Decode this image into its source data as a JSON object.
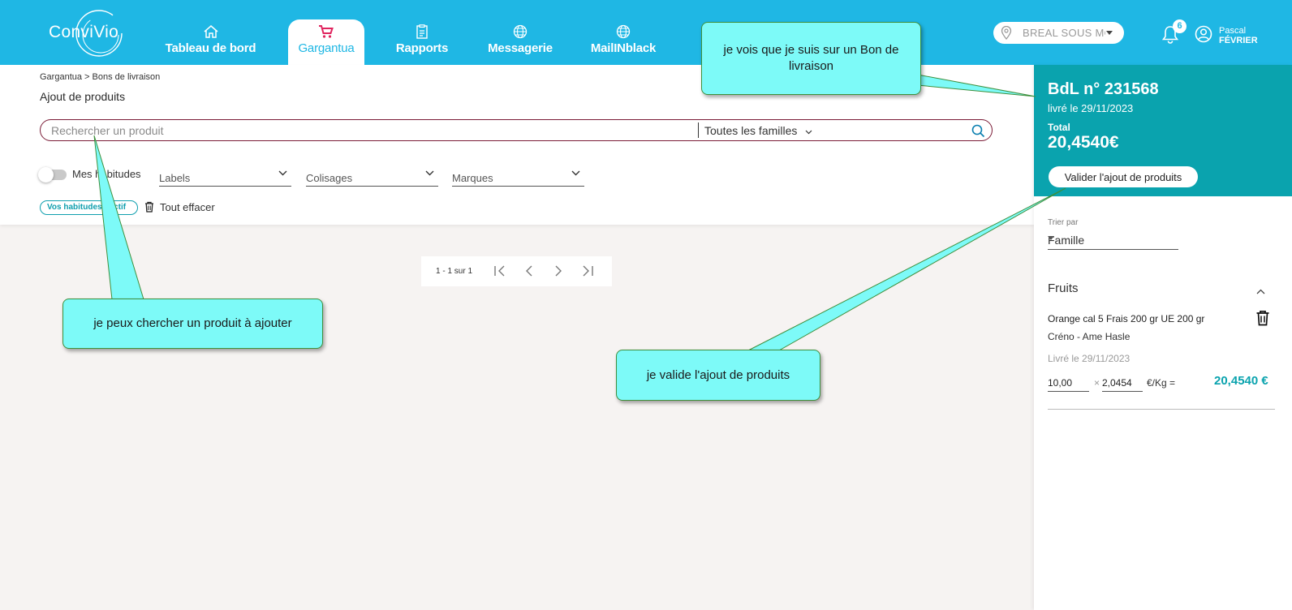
{
  "app": {
    "logo_text": "ConviVio"
  },
  "nav": [
    {
      "label": "Tableau de bord",
      "icon": "home-icon"
    },
    {
      "label": "Gargantua",
      "icon": "cart-icon",
      "active": true
    },
    {
      "label": "Rapports",
      "icon": "report-icon"
    },
    {
      "label": "Messagerie",
      "icon": "globe-icon"
    },
    {
      "label": "MailINblack",
      "icon": "globe-icon"
    }
  ],
  "header": {
    "location": "BREAL SOUS MONTFORT",
    "notifications_count": "6",
    "user_first": "Pascal",
    "user_last": "FÉVRIER"
  },
  "main": {
    "breadcrumb": "Gargantua > Bons de livraison",
    "title": "Ajout de produits",
    "search_placeholder": "Rechercher un produit",
    "families_label": "Toutes les familles",
    "toggle_label": "Mes habitudes",
    "filters": [
      "Labels",
      "Colisages",
      "Marques"
    ],
    "chip": "Vos habitudes : actif",
    "clear_all": "Tout effacer",
    "pagination": "1 - 1 sur 1"
  },
  "bdl": {
    "number": "BdL n° 231568",
    "delivered": "livré le 29/11/2023",
    "total_label": "Total",
    "total": "20,4540€",
    "validate_label": "Valider l'ajout de produits"
  },
  "cart": {
    "sort_label": "Trier par",
    "sort_value": "Famille",
    "section": "Fruits",
    "product": {
      "name": "Orange cal 5 Frais 200 gr UE 200 gr",
      "supplier": "Créno - Ame Hasle",
      "delivered": "Livré le 29/11/2023",
      "qty": "10,00",
      "times": "×",
      "unit_price": "2,0454",
      "unit": "€/Kg =",
      "line_total": "20,4540 €"
    }
  },
  "callouts": {
    "search": "je peux chercher un produit à ajouter",
    "bdl": "je vois que je suis sur un Bon de livraison",
    "validate": "je valide l'ajout de produits"
  },
  "colors": {
    "header": "#1fb7e4",
    "accent_teal": "#0aa3ae",
    "callout": "#7dfaf8",
    "active_nav_text": "#1fb7e4"
  }
}
